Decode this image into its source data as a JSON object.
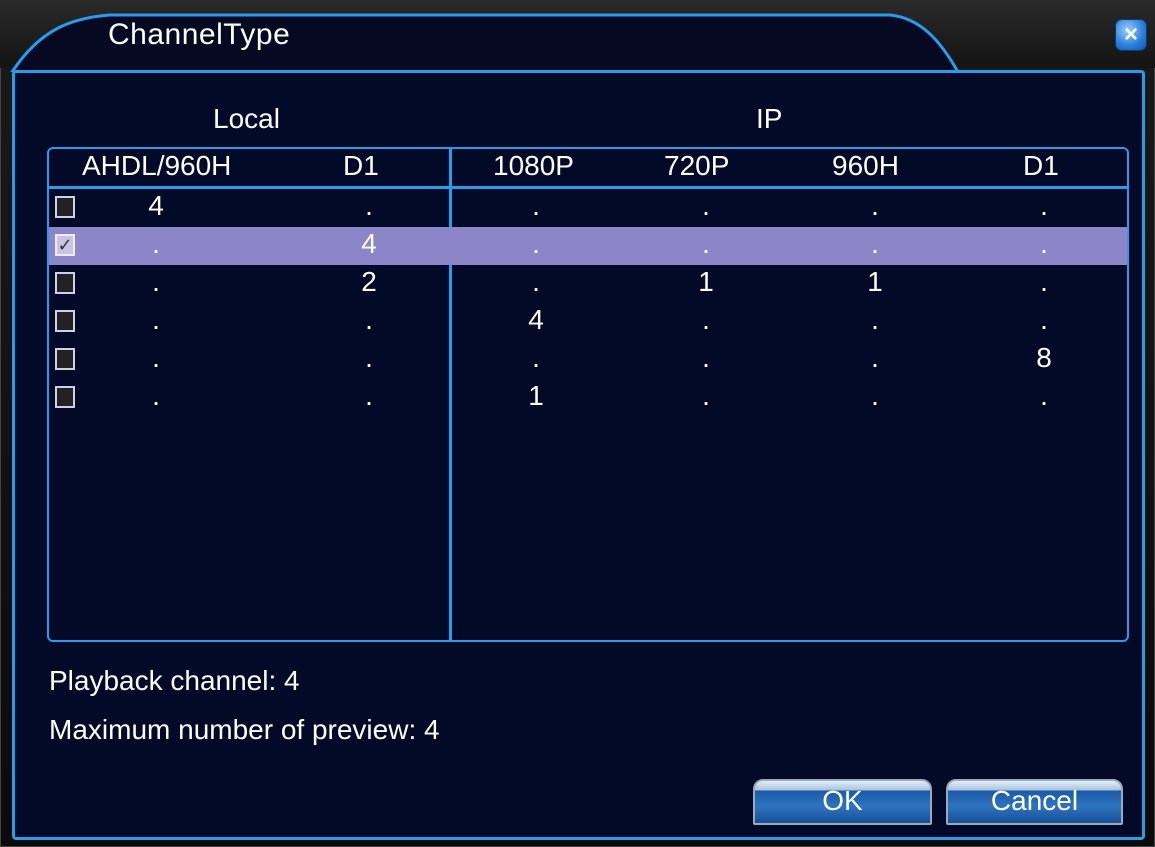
{
  "dialog": {
    "title": "ChannelType",
    "close_label": "×"
  },
  "groups": {
    "local": "Local",
    "ip": "IP"
  },
  "columns": [
    "AHDL/960H",
    "D1",
    "1080P",
    "720P",
    "960H",
    "D1"
  ],
  "rows": [
    {
      "checked": false,
      "values": [
        "4",
        ".",
        ".",
        ".",
        ".",
        "."
      ]
    },
    {
      "checked": true,
      "values": [
        ".",
        "4",
        ".",
        ".",
        ".",
        "."
      ]
    },
    {
      "checked": false,
      "values": [
        ".",
        "2",
        ".",
        "1",
        "1",
        "."
      ]
    },
    {
      "checked": false,
      "values": [
        ".",
        ".",
        "4",
        ".",
        ".",
        "."
      ]
    },
    {
      "checked": false,
      "values": [
        ".",
        ".",
        ".",
        ".",
        ".",
        "8"
      ]
    },
    {
      "checked": false,
      "values": [
        ".",
        ".",
        "1",
        ".",
        ".",
        "."
      ]
    }
  ],
  "info": {
    "playback": "Playback channel: 4",
    "max_preview": "Maximum number of preview: 4"
  },
  "buttons": {
    "ok": "OK",
    "cancel": "Cancel"
  },
  "colors": {
    "accent": "#2a9be8",
    "panel_bg": "#020a28",
    "selected_row": "#8c86c8"
  }
}
